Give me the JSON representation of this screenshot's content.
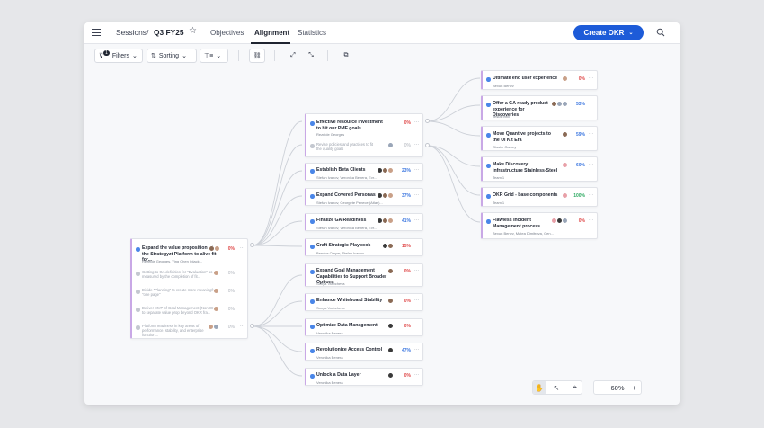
{
  "header": {
    "crumb_root": "Sessions",
    "crumb_sep": "/",
    "crumb_current": "Q3 FY25",
    "tabs": [
      {
        "label": "Objectives"
      },
      {
        "label": "Alignment"
      },
      {
        "label": "Statistics"
      }
    ],
    "create_label": "Create OKR"
  },
  "toolbar": {
    "filters_label": "Filters",
    "filters_count": "1",
    "sorting_label": "Sorting"
  },
  "zoom": {
    "value": "60%",
    "minus": "−",
    "plus": "+"
  },
  "nodes": {
    "root": {
      "title": "Expand the value proposition of the Strategyzt Platform to alive fit for...",
      "sub": "Rezeide Georges, Ying Chen (black...",
      "pct": "0%",
      "krs": [
        {
          "title": "Getting to GA definition for \"Evaluation\" as measured by the completion of fit...",
          "pct": "0%"
        },
        {
          "title": "Divide \"Planning\" to create more meaningful \"one page\"",
          "pct": "0%"
        },
        {
          "title": "Deliver MVP of Goal Management (Non OKR) to separate value prop beyond OKR fra...",
          "pct": "0%"
        },
        {
          "title": "Platform readiness in key areas of performance, stability, and enterprise function...",
          "pct": "0%"
        }
      ]
    },
    "mid": [
      {
        "title": "Effective resource investment to hit our PMF goals",
        "sub": "Rezeide Georges",
        "pct": "0%",
        "kr": {
          "title": "Revise policies and practices to fit the quality goals",
          "pct": "0%"
        }
      },
      {
        "title": "Establish Beta Clients",
        "sub": "Stefan Ivanov, Veronika Benera, Evr...",
        "pct": "23%"
      },
      {
        "title": "Expand Covered Personas",
        "sub": "Stefan Ivanov, Georgete Penece (Atlas)...",
        "pct": "37%"
      },
      {
        "title": "Finalize GA Readiness",
        "sub": "Stefan Ivanov, Veronika Benera, Evr...",
        "pct": "41%"
      },
      {
        "title": "Craft Strategic Playbook",
        "sub": "Bernice Olayar, Stefan Ivanov",
        "pct": "15%"
      },
      {
        "title": "Expand Goal Management Capabilities to Support Broader Options",
        "sub": "Sonya Vrabcheva",
        "pct": "0%"
      },
      {
        "title": "Enhance Whiteboard Stability",
        "sub": "Sonya Vrabcheva",
        "pct": "0%"
      },
      {
        "title": "Optimize Data Management",
        "sub": "Veronika Benera",
        "pct": "0%"
      },
      {
        "title": "Revolutionize Access Control",
        "sub": "Veronika Benera",
        "pct": "47%"
      },
      {
        "title": "Unlock a Data Layer",
        "sub": "Veronika Benera",
        "pct": "0%"
      }
    ],
    "right": [
      {
        "title": "Ultimate end user experience",
        "sub": "Bexun Benev",
        "pct": "0%"
      },
      {
        "title": "Offer a GA ready product experience for Discoveries",
        "sub": "Jesus Infill",
        "pct": "53%"
      },
      {
        "title": "Move Quantive projects to the UI Kit Era",
        "sub": "Gissim Gamey",
        "pct": "59%"
      },
      {
        "title": "Make Discovery Infrastructure Stainless-Steel",
        "sub": "Team 1",
        "pct": "60%"
      },
      {
        "title": "OKR Grid - base components",
        "sub": "Team 1",
        "pct": "100%"
      },
      {
        "title": "Flawless Incident Management process",
        "sub": "Bexun Benev, Matea Dimitrova, Gen...",
        "pct": "0%"
      }
    ]
  },
  "colors": {
    "accent": "#1d5bd8",
    "card_border": "#c9a8e6",
    "dot": "#4a86e8"
  }
}
